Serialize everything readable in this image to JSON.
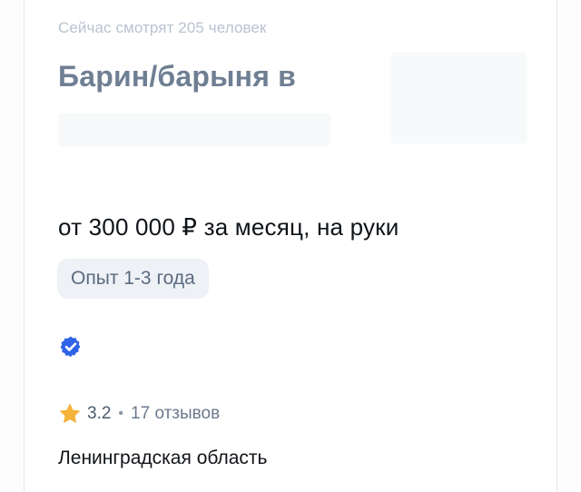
{
  "vacancy": {
    "viewers_text": "Сейчас смотрят 205 человек",
    "title": "Барин/барыня в",
    "salary": "от 300 000 ₽ за месяц, на руки",
    "experience": "Опыт 1-3 года",
    "rating": "3.2",
    "separator": "•",
    "reviews": "17 отзывов",
    "region": "Ленинградская область"
  },
  "colors": {
    "verified_badge": "#2f63e8",
    "star": "#f5b33a",
    "title": "#6f7f93",
    "chip_background": "#eef1f6"
  },
  "icons": {
    "verified": "verified-check-icon",
    "rating": "star-icon"
  }
}
